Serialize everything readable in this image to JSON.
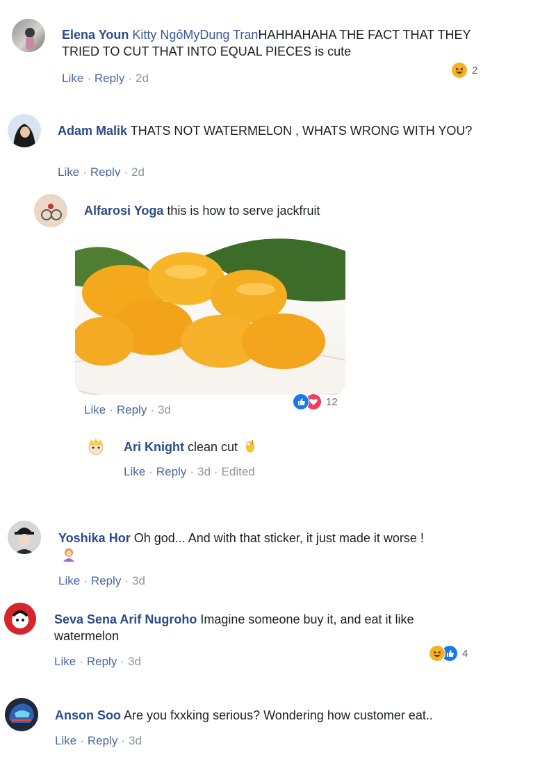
{
  "comments": [
    {
      "author": "Elena Youn",
      "mention": "Kitty NgôMyDung Tran",
      "text": "HAHHAHAHA THE FACT THAT THEY TRIED TO CUT THAT INTO EQUAL PIECES is cute",
      "like": "Like",
      "reply": "Reply",
      "time": "2d",
      "reaction_count": "2",
      "reactions": [
        "haha-icon"
      ]
    },
    {
      "author": "Adam Malik",
      "text": "THATS NOT WATERMELON , WHATS WRONG WITH YOU?",
      "like": "Like",
      "reply": "Reply",
      "time": "2d"
    },
    {
      "author": "Alfarosi Yoga",
      "text": "this is how to serve jackfruit",
      "like": "Like",
      "reply": "Reply",
      "time": "3d",
      "reaction_count": "12",
      "reactions": [
        "like-icon",
        "love-icon"
      ]
    },
    {
      "author": "Ari Knight",
      "text": "clean cut",
      "like": "Like",
      "reply": "Reply",
      "time": "3d",
      "edited": "Edited",
      "emoji": "ok-hand-icon"
    },
    {
      "author": "Yoshika Hor",
      "text": "Oh god... And with that sticker, it just made it worse !",
      "like": "Like",
      "reply": "Reply",
      "time": "3d",
      "emoji": "woman-facepalming-icon"
    },
    {
      "author": "Seva Sena Arif Nugroho",
      "text": "Imagine someone buy it, and eat it like watermelon",
      "like": "Like",
      "reply": "Reply",
      "time": "3d",
      "reaction_count": "4",
      "reactions": [
        "haha-icon",
        "like-icon"
      ]
    },
    {
      "author": "Anson Soo",
      "text": "Are you fxxking serious? Wondering how customer eat..",
      "like": "Like",
      "reply": "Reply",
      "time": "3d"
    }
  ],
  "colors": {
    "author": "#2b4a8b",
    "link": "#4b67a1",
    "muted": "#90949c",
    "haha": "#f7b125",
    "like": "#1877f2",
    "love": "#f33e58"
  }
}
